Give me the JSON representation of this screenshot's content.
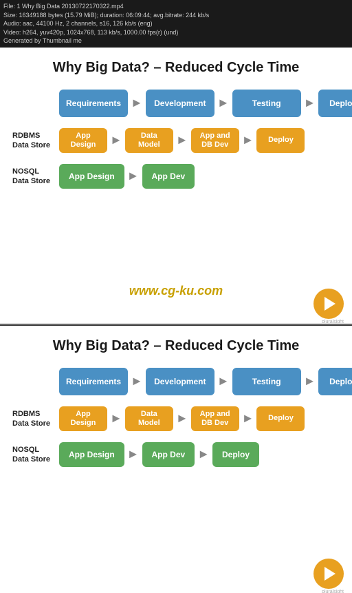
{
  "topbar": {
    "line1": "File: 1 Why Big Data 20130722170322.mp4",
    "line2": "Size: 16349188 bytes (15.79 MiB); duration: 06:09:44; avg.bitrate: 244 kb/s",
    "line3": "Audio: aac, 44100 Hz, 2 channels, s16, 126 kb/s (eng)",
    "line4": "Video: h264, yuv420p, 1024x768, 113 kb/s, 1000.00 fps(r) (und)",
    "line5": "Generated by Thumbnail me"
  },
  "slides": [
    {
      "id": "top",
      "title": "Why Big Data? – Reduced Cycle Time",
      "row1": {
        "label": "",
        "boxes": [
          "Requirements",
          "Development",
          "Testing",
          "Deployment"
        ],
        "color": "blue"
      },
      "row2": {
        "label": "RDBMS\nData Store",
        "boxes": [
          "App\nDesign",
          "Data\nModel",
          "App and\nDB Dev",
          "Deploy"
        ],
        "color": "orange"
      },
      "row3": {
        "label": "NOSQL\nData Store",
        "boxes": [
          "App Design",
          "App Dev"
        ],
        "color": "green"
      },
      "watermark": "www.cg-ku.com"
    },
    {
      "id": "bottom",
      "title": "Why Big Data? – Reduced Cycle Time",
      "row1": {
        "label": "",
        "boxes": [
          "Requirements",
          "Development",
          "Testing",
          "Deployment"
        ],
        "color": "blue"
      },
      "row2": {
        "label": "RDBMS\nData Store",
        "boxes": [
          "App\nDesign",
          "Data\nModel",
          "App and\nDB Dev",
          "Deploy"
        ],
        "color": "orange"
      },
      "row3": {
        "label": "NOSQL\nData Store",
        "boxes": [
          "App Design",
          "App Dev",
          "Deploy"
        ],
        "color": "green"
      }
    }
  ]
}
